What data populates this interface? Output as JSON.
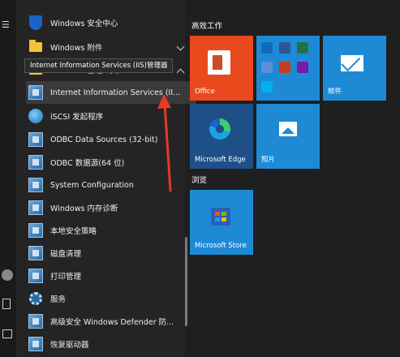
{
  "app_list": {
    "items": [
      {
        "label": "Windows 安全中心",
        "icon": "shield-icon"
      },
      {
        "label": "Windows 附件",
        "icon": "folder-icon",
        "chevron": "down"
      },
      {
        "label": "Windows 管理工具",
        "icon": "folder-icon",
        "chevron": "up"
      },
      {
        "label": "Internet Information Services (II...",
        "icon": "iis-icon",
        "selected": true
      },
      {
        "label": "iSCSI 发起程序",
        "icon": "iscsi-icon"
      },
      {
        "label": "ODBC Data Sources (32-bit)",
        "icon": "odbc-icon"
      },
      {
        "label": "ODBC 数据源(64 位)",
        "icon": "odbc-icon"
      },
      {
        "label": "System Configuration",
        "icon": "config-icon"
      },
      {
        "label": "Windows 内存诊断",
        "icon": "memory-icon"
      },
      {
        "label": "本地安全策略",
        "icon": "security-policy-icon"
      },
      {
        "label": "磁盘清理",
        "icon": "disk-cleanup-icon"
      },
      {
        "label": "打印管理",
        "icon": "print-icon"
      },
      {
        "label": "服务",
        "icon": "services-gear-icon"
      },
      {
        "label": "高级安全 Windows Defender 防...",
        "icon": "firewall-icon"
      },
      {
        "label": "恢复驱动器",
        "icon": "recovery-icon"
      }
    ]
  },
  "tooltip": {
    "text": "Internet Information Services (IIS)管理器"
  },
  "tiles": {
    "group1_title": "高效工作",
    "group2_title": "浏览",
    "office": "Office",
    "mail": "邮件",
    "edge": "Microsoft Edge",
    "photos": "照片",
    "store": "Microsoft Store"
  },
  "colors": {
    "accent": "#1e8ad6",
    "office_tile": "#e8491d",
    "arrow": "#e63a24"
  }
}
